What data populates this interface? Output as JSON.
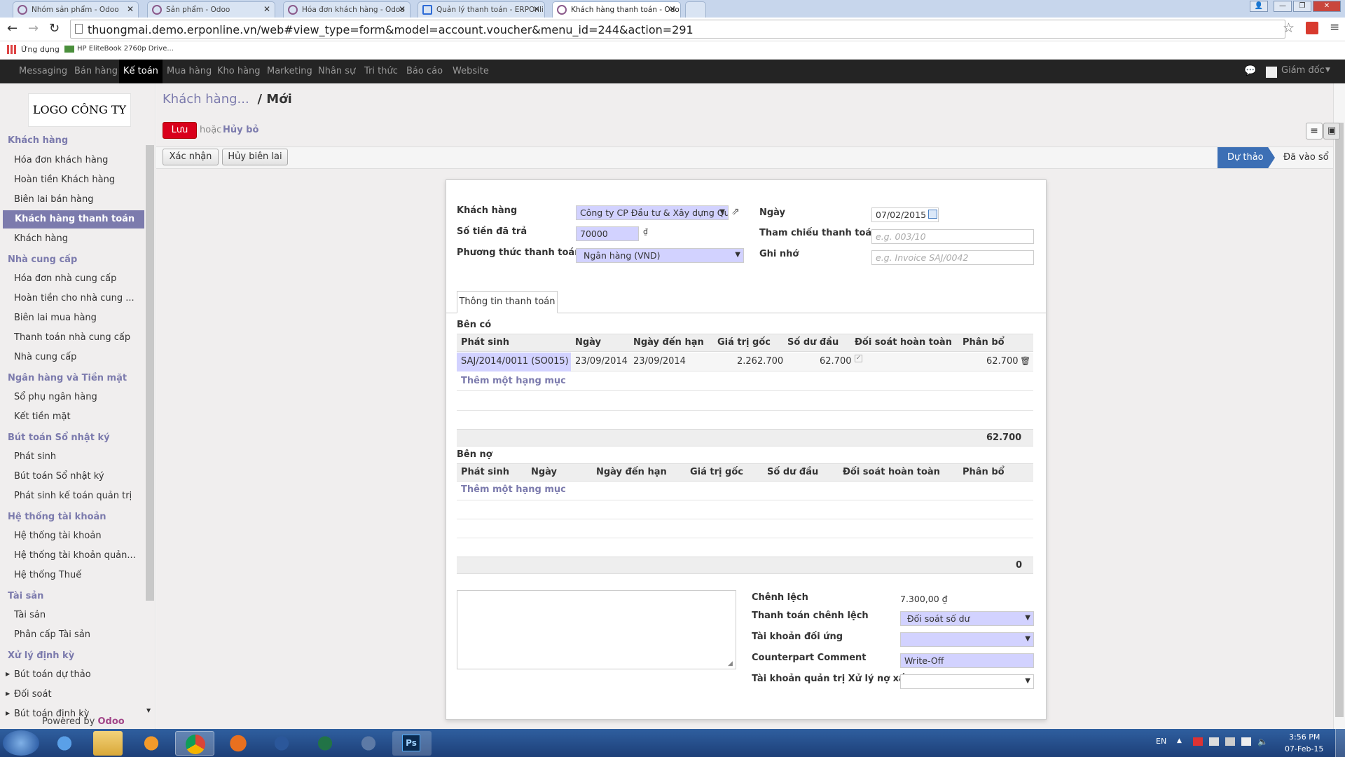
{
  "browser": {
    "tabs": [
      {
        "title": "Nhóm sản phẩm - Odoo"
      },
      {
        "title": "Sản phẩm - Odoo"
      },
      {
        "title": "Hóa đơn khách hàng - Odoo"
      },
      {
        "title": "Quản lý thanh toán - ERPOnli"
      },
      {
        "title": "Khách hàng thanh toán - Odo"
      }
    ],
    "url": "thuongmai.demo.erponline.vn/web#view_type=form&model=account.voucher&menu_id=244&action=291",
    "bookmarks": [
      "Ứng dụng",
      "HP EliteBook 2760p Drive..."
    ]
  },
  "topnav": {
    "items": [
      "Messaging",
      "Bán hàng",
      "Kế toán",
      "Mua hàng",
      "Kho hàng",
      "Marketing",
      "Nhân sự",
      "Tri thức",
      "Báo cáo",
      "Website"
    ],
    "user": "Giám đốc"
  },
  "sidebar": {
    "logo": "LOGO CÔNG TY",
    "sections": [
      {
        "title": "Khách hàng",
        "items": [
          "Hóa đơn khách hàng",
          "Hoàn tiền Khách hàng",
          "Biên lai bán hàng",
          "Khách hàng thanh toán",
          "Khách hàng"
        ]
      },
      {
        "title": "Nhà cung cấp",
        "items": [
          "Hóa đơn nhà cung cấp",
          "Hoàn tiền cho nhà cung ...",
          "Biên lai mua hàng",
          "Thanh toán nhà cung cấp",
          "Nhà cung cấp"
        ]
      },
      {
        "title": "Ngân hàng và Tiền mặt",
        "items": [
          "Sổ phụ ngân hàng",
          "Kết tiền mặt"
        ]
      },
      {
        "title": "Bút toán Sổ nhật ký",
        "items": [
          "Phát sinh",
          "Bút toán Sổ nhật ký",
          "Phát sinh kế toán quản trị"
        ]
      },
      {
        "title": "Hệ thống tài khoản",
        "items": [
          "Hệ thống tài khoản",
          "Hệ thống tài khoản quản...",
          "Hệ thống Thuế"
        ]
      },
      {
        "title": "Tài sản",
        "items": [
          "Tài sản",
          "Phân cấp Tài sản"
        ]
      },
      {
        "title": "Xử lý định kỳ",
        "items": [
          "Bút toán dự thảo",
          "Đối soát",
          "Bút toán định kỳ"
        ]
      }
    ],
    "powered_by": "Powered by",
    "powered_brand": "Odoo"
  },
  "header": {
    "breadcrumb_parent": "Khách hàng...",
    "breadcrumb_current": "/ Mới",
    "save": "Lưu",
    "or": "hoặc",
    "discard": "Hủy bỏ",
    "confirm": "Xác nhận",
    "cancel_receipt": "Hủy biên lai",
    "status_draft": "Dự thảo",
    "status_posted": "Đã vào sổ"
  },
  "form": {
    "customer_label": "Khách hàng",
    "customer_value": "Công ty CP Đầu tư & Xây dựng Qu",
    "paid_label": "Số tiền đã trả",
    "paid_value": "70000",
    "currency": "₫",
    "method_label": "Phương thức thanh toán",
    "method_value": "Ngân hàng (VND)",
    "date_label": "Ngày",
    "date_value": "07/02/2015",
    "ref_label": "Tham chiếu thanh toán",
    "ref_placeholder": "e.g. 003/10",
    "memo_label": "Ghi nhớ",
    "memo_placeholder": "e.g. Invoice SAJ/0042",
    "tab_label": "Thông tin thanh toán"
  },
  "credit": {
    "title": "Bên có",
    "columns": [
      "Phát sinh",
      "Ngày",
      "Ngày đến hạn",
      "Giá trị gốc",
      "Số dư đầu",
      "Đối soát hoàn toàn",
      "Phân bổ"
    ],
    "rows": [
      {
        "move": "SAJ/2014/0011 (SO015)",
        "date": "23/09/2014",
        "due": "23/09/2014",
        "original": "2.262.700",
        "opening": "62.700",
        "reconciled": true,
        "allocation": "62.700"
      }
    ],
    "add_item": "Thêm một hạng mục",
    "total": "62.700"
  },
  "debit": {
    "title": "Bên nợ",
    "columns": [
      "Phát sinh",
      "Ngày",
      "Ngày đến hạn",
      "Giá trị gốc",
      "Số dư đầu",
      "Đối soát hoàn toàn",
      "Phân bổ"
    ],
    "add_item": "Thêm một hạng mục",
    "total": "0"
  },
  "difference": {
    "diff_label": "Chênh lệch",
    "diff_value": "7.300,00 ₫",
    "payment_diff_label": "Thanh toán chênh lệch",
    "payment_diff_value": "Đối soát số dư",
    "counter_account_label": "Tài khoản đối ứng",
    "comment_label": "Counterpart Comment",
    "comment_value": "Write-Off",
    "analytic_label": "Tài khoản quản trị Xử lý nợ xấu"
  },
  "taskbar": {
    "lang": "EN",
    "time": "3:56 PM",
    "date": "07-Feb-15"
  }
}
